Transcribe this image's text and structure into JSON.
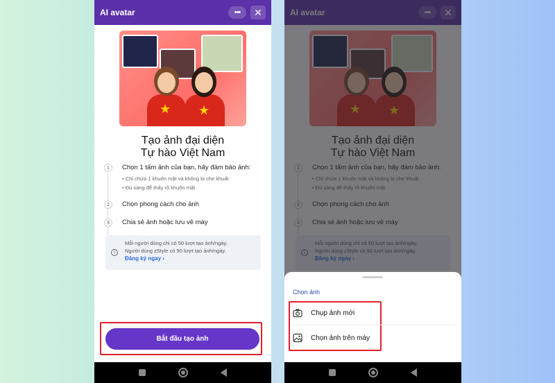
{
  "app": {
    "title": "AI avatar",
    "more_icon": "more-dots-icon",
    "close_icon": "close-icon"
  },
  "intro": {
    "heading_line1": "Tạo ảnh đại diện",
    "heading_line2": "Tự hào Việt Nam"
  },
  "steps": [
    {
      "num": "1",
      "text": "Chọn 1 tấm ảnh của bạn, hãy đảm bảo ảnh:",
      "bullets": [
        "Chỉ chứa 1 khuôn mặt và không bị che khuất",
        "Đủ sáng để thấy rõ khuôn mặt"
      ]
    },
    {
      "num": "2",
      "text": "Chọn phong cách cho ảnh"
    },
    {
      "num": "3",
      "text": "Chia sẻ ảnh hoặc lưu về máy"
    }
  ],
  "notice": {
    "line1": "Mỗi người dùng chỉ có 50 lượt tạo ảnh/ngày.",
    "line2": "Người dùng zStyle có 90 lượt tạo ảnh/ngày.",
    "link": "Đăng ký ngay",
    "link_arrow": "›"
  },
  "cta": {
    "label": "Bắt đầu tạo ảnh"
  },
  "sheet": {
    "title": "Chọn ảnh",
    "options": [
      {
        "label": "Chụp ảnh mới",
        "icon": "camera-icon"
      },
      {
        "label": "Chọn ảnh trên máy",
        "icon": "gallery-icon"
      }
    ]
  },
  "colors": {
    "header": "#5b30a8",
    "button": "#6636c9",
    "highlight": "#e2202a",
    "link": "#2d6bd8"
  }
}
